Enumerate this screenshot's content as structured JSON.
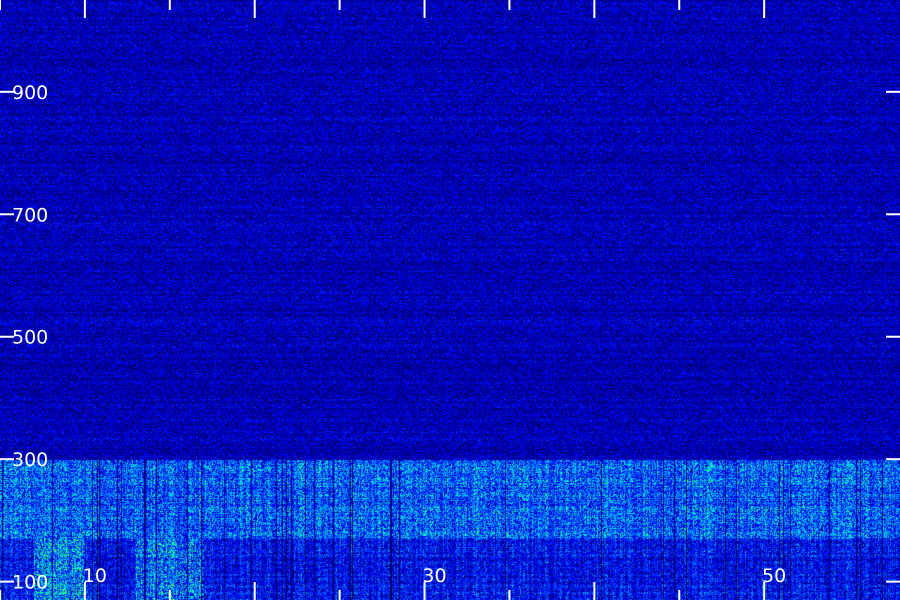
{
  "chart_data": {
    "type": "heatmap",
    "title": "",
    "xlabel": "",
    "ylabel": "",
    "x_range": [
      5,
      58
    ],
    "y_range": [
      70,
      1050
    ],
    "x_ticks": [
      10,
      20,
      30,
      40,
      50
    ],
    "x_tick_labels": [
      "10",
      "30",
      "50"
    ],
    "x_labeled_ticks": [
      10,
      30,
      50
    ],
    "y_ticks": [
      100,
      300,
      500,
      700,
      900
    ],
    "y_tick_labels": [
      "100",
      "300",
      "500",
      "700",
      "900"
    ],
    "grid": false,
    "colormap": [
      "#000018",
      "#00007a",
      "#0000ff",
      "#0060ff",
      "#00c8ff",
      "#00ffb0",
      "#40ff40"
    ],
    "intensity_bands": [
      {
        "y_from": 300,
        "y_to": 1050,
        "level": 0.3
      },
      {
        "y_from": 170,
        "y_to": 300,
        "level": 0.62
      },
      {
        "y_from": 70,
        "y_to": 170,
        "level": 0.42
      }
    ],
    "hot_regions": [
      {
        "x_from": 7,
        "x_to": 10,
        "y_from": 70,
        "y_to": 170,
        "level": 0.95
      },
      {
        "x_from": 13,
        "x_to": 17,
        "y_from": 70,
        "y_to": 170,
        "level": 0.9
      }
    ]
  }
}
